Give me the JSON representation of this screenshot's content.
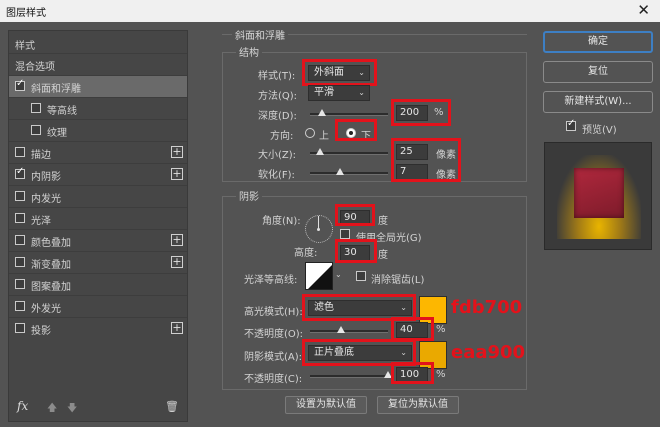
{
  "window": {
    "title": "图层样式",
    "close": "✕"
  },
  "left_panel": {
    "header_styles": "样式",
    "header_blend": "混合选项",
    "items": [
      {
        "label": "斜面和浮雕",
        "checked": true,
        "plus": false,
        "indent": false,
        "selected": true
      },
      {
        "label": "等高线",
        "checked": false,
        "plus": false,
        "indent": true,
        "selected": false
      },
      {
        "label": "纹理",
        "checked": false,
        "plus": false,
        "indent": true,
        "selected": false
      },
      {
        "label": "描边",
        "checked": false,
        "plus": true,
        "indent": false,
        "selected": false
      },
      {
        "label": "内阴影",
        "checked": true,
        "plus": true,
        "indent": false,
        "selected": false
      },
      {
        "label": "内发光",
        "checked": false,
        "plus": false,
        "indent": false,
        "selected": false
      },
      {
        "label": "光泽",
        "checked": false,
        "plus": false,
        "indent": false,
        "selected": false
      },
      {
        "label": "颜色叠加",
        "checked": false,
        "plus": true,
        "indent": false,
        "selected": false
      },
      {
        "label": "渐变叠加",
        "checked": false,
        "plus": true,
        "indent": false,
        "selected": false
      },
      {
        "label": "图案叠加",
        "checked": false,
        "plus": false,
        "indent": false,
        "selected": false
      },
      {
        "label": "外发光",
        "checked": false,
        "plus": false,
        "indent": false,
        "selected": false
      },
      {
        "label": "投影",
        "checked": false,
        "plus": true,
        "indent": false,
        "selected": false
      }
    ],
    "fx_label": "fx"
  },
  "bevel": {
    "section_title": "斜面和浮雕",
    "structure_title": "结构",
    "style_label": "样式(T):",
    "style_value": "外斜面",
    "method_label": "方法(Q):",
    "method_value": "平滑",
    "depth_label": "深度(D):",
    "depth_value": "200",
    "depth_unit": "%",
    "direction_label": "方向:",
    "direction_up": "上",
    "direction_down": "下",
    "size_label": "大小(Z):",
    "size_value": "25",
    "size_unit": "像素",
    "soften_label": "软化(F):",
    "soften_value": "7",
    "soften_unit": "像素"
  },
  "shading": {
    "title": "阴影",
    "angle_label": "角度(N):",
    "angle_value": "90",
    "angle_unit": "度",
    "global_light_label": "使用全局光(G)",
    "altitude_label": "高度:",
    "altitude_value": "30",
    "altitude_unit": "度",
    "gloss_label": "光泽等高线:",
    "antialias_label": "消除锯齿(L)",
    "highlight_mode_label": "高光模式(H):",
    "highlight_mode_value": "滤色",
    "highlight_color": "#fdb700",
    "highlight_annotation": "fdb700",
    "highlight_opacity_label": "不透明度(O):",
    "highlight_opacity_value": "40",
    "shadow_mode_label": "阴影模式(A):",
    "shadow_mode_value": "正片叠底",
    "shadow_color": "#eaa900",
    "shadow_annotation": "eaa900",
    "shadow_opacity_label": "不透明度(C):",
    "shadow_opacity_value": "100",
    "percent": "%"
  },
  "bottom_buttons": {
    "set_default": "设置为默认值",
    "reset_default": "复位为默认值"
  },
  "right": {
    "ok": "确定",
    "reset": "复位",
    "new_style": "新建样式(W)...",
    "preview_label": "预览(V)"
  }
}
